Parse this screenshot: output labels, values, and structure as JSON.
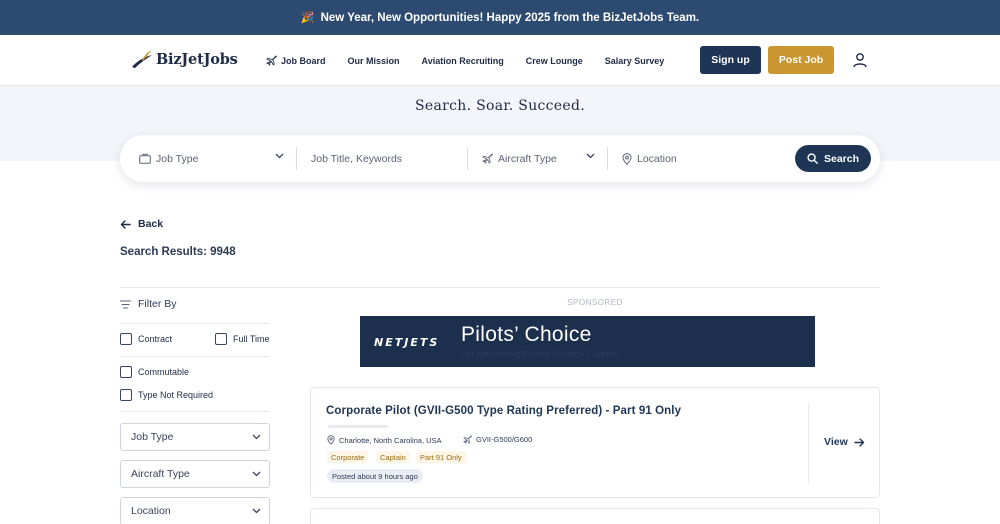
{
  "announcement": {
    "emoji": "🎉",
    "text": "New Year, New Opportunities! Happy 2025 from the BizJetJobs Team."
  },
  "brand": {
    "name": "BizJetJobs"
  },
  "nav": [
    {
      "label": "Job Board",
      "icon": "airplane-icon"
    },
    {
      "label": "Our Mission"
    },
    {
      "label": "Aviation Recruiting"
    },
    {
      "label": "Crew Lounge"
    },
    {
      "label": "Salary Survey"
    }
  ],
  "header_buttons": {
    "signup": "Sign up",
    "post_job": "Post Job"
  },
  "hero": {
    "tagline": "Search. Soar. Succeed."
  },
  "search": {
    "job_type": "Job Type",
    "keywords_placeholder": "Job Title, Keywords",
    "aircraft_type": "Aircraft Type",
    "location_placeholder": "Location",
    "button": "Search"
  },
  "back_label": "Back",
  "results_label": "Search Results: 9948",
  "filters": {
    "heading": "Filter By",
    "checkboxes": [
      "Contract",
      "Full Time",
      "Commutable",
      "Type Not Required"
    ],
    "selects": [
      "Job Type",
      "Aircraft Type",
      "Location"
    ]
  },
  "sponsored_label": "SPONSORED",
  "banner": {
    "brand": "NETJETS",
    "title": "Pilots’ Choice",
    "subtitle": "For Rewarding Private Aviation Careers"
  },
  "job": {
    "title": "Corporate Pilot (GVII-G500 Type Rating Preferred) - Part 91 Only",
    "location": "Charlotte, North Carolina, USA",
    "aircraft": "GVII-G500/G600",
    "tags": [
      "Corporate",
      "Captain",
      "Part 91 Only"
    ],
    "posted": "Posted about 9 hours ago",
    "view_label": "View"
  },
  "colors": {
    "navy": "#1f3556",
    "announce": "#2d4a70",
    "gold": "#c9962f",
    "tag_bg": "#fdf6e6",
    "tag_text": "#9a6c14"
  }
}
